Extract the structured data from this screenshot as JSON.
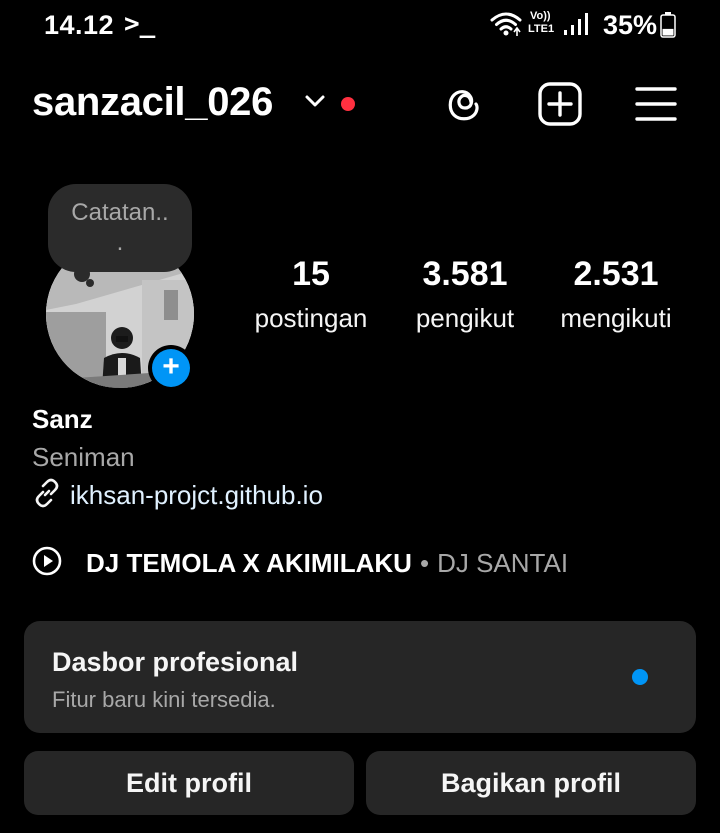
{
  "status_bar": {
    "time": "14.12",
    "terminal_glyph": ">_",
    "volte_top": "Vo))",
    "volte_bottom": "LTE1",
    "battery_percent": "35%",
    "battery_level": 0.35
  },
  "header": {
    "username": "sanzacil_026",
    "icons": [
      "chevron-down-icon",
      "threads-icon",
      "create-icon",
      "menu-icon"
    ]
  },
  "note": {
    "text": "Catatan..\n."
  },
  "stats": [
    {
      "value": "15",
      "label": "postingan"
    },
    {
      "value": "3.581",
      "label": "pengikut"
    },
    {
      "value": "2.531",
      "label": "mengikuti"
    }
  ],
  "bio": {
    "name": "Sanz",
    "category": "Seniman",
    "link": "ikhsan-projct.github.io"
  },
  "music": {
    "title": "DJ TEMOLA X AKIMILAKU",
    "separator": "•",
    "artist": "DJ SANTAI"
  },
  "dashboard": {
    "title": "Dasbor profesional",
    "subtitle": "Fitur baru kini tersedia."
  },
  "buttons": {
    "edit": "Edit profil",
    "share": "Bagikan profil"
  },
  "colors": {
    "background": "#000000",
    "accent_blue": "#0095f6",
    "notification_red": "#ff3040",
    "card": "#262626"
  }
}
